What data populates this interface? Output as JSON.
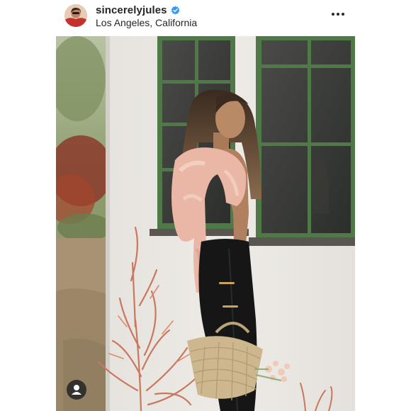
{
  "post": {
    "username": "sincerelyjules",
    "location": "Los Angeles, California"
  },
  "icons": {
    "avatar": "profile-avatar",
    "verified": "verified-badge-icon",
    "more": "more-options-icon",
    "user_tag": "tagged-users-icon"
  },
  "colors": {
    "verified_blue": "#3897f0",
    "text": "#262626",
    "window_frame_green": "#4f7a48"
  }
}
